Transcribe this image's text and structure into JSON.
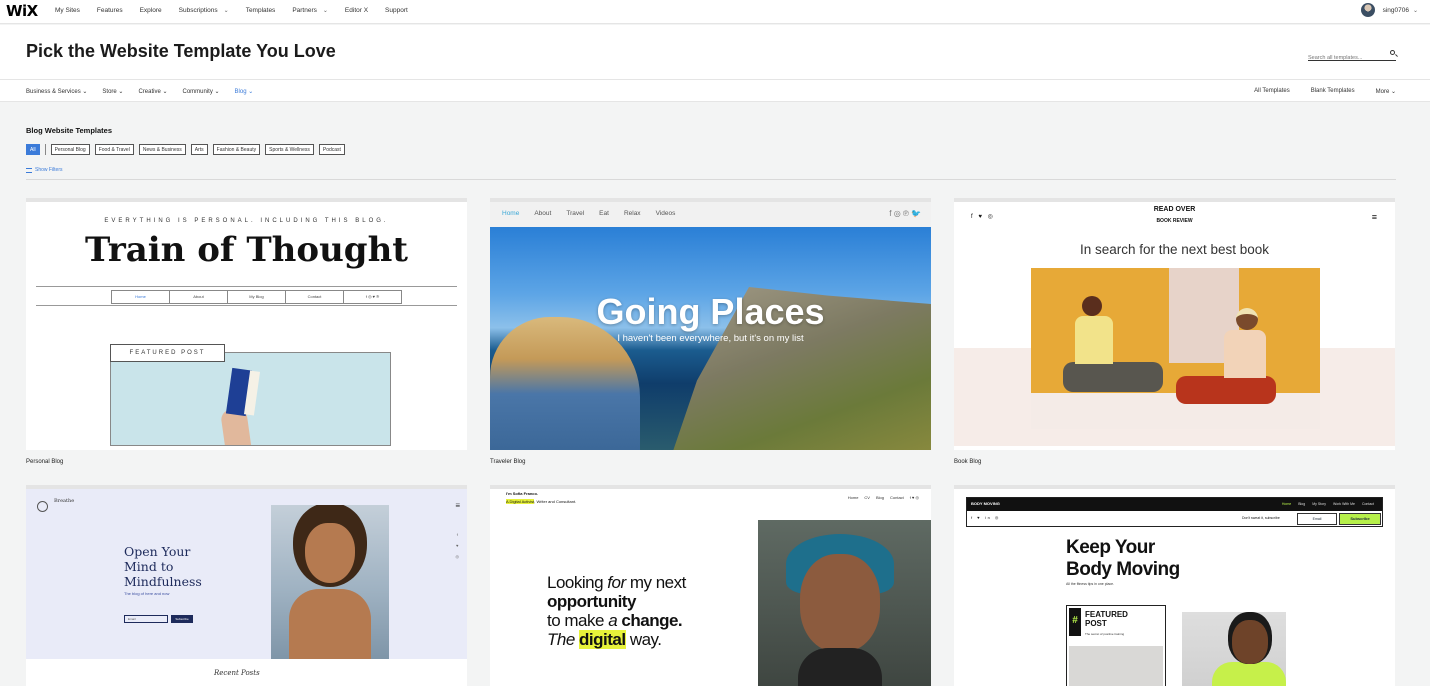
{
  "topnav": {
    "logo": "WiX",
    "items": [
      {
        "label": "My Sites",
        "chevron": false
      },
      {
        "label": "Features",
        "chevron": false
      },
      {
        "label": "Explore",
        "chevron": false
      },
      {
        "label": "Subscriptions",
        "chevron": true
      },
      {
        "label": "Templates",
        "chevron": false
      },
      {
        "label": "Partners",
        "chevron": true
      },
      {
        "label": "Editor X",
        "chevron": false
      },
      {
        "label": "Support",
        "chevron": false
      }
    ],
    "username": "sing0706"
  },
  "header": {
    "title": "Pick the Website Template You Love",
    "search_placeholder": "Search all templates..."
  },
  "categories": {
    "left": [
      "Business & Services",
      "Store",
      "Creative",
      "Community",
      "Blog"
    ],
    "active": "Blog",
    "right": [
      "All Templates",
      "Blank Templates",
      "More"
    ]
  },
  "section": {
    "title": "Blog Website Templates",
    "chips": [
      "All",
      "Personal Blog",
      "Food & Travel",
      "News & Business",
      "Arts",
      "Fashion & Beauty",
      "Sports & Wellness",
      "Podcast"
    ],
    "active_chip": "All",
    "show_filters": "Show Filters"
  },
  "cards": {
    "personal": {
      "label": "Personal Blog",
      "tagline": "EVERYTHING IS PERSONAL. INCLUDING THIS BLOG.",
      "title": "Train of Thought",
      "nav": [
        "Home",
        "About",
        "My Blog",
        "Contact",
        "f ◎ ♥ ℗"
      ],
      "featured": "FEATURED POST"
    },
    "traveler": {
      "label": "Traveler Blog",
      "nav": [
        "Home",
        "About",
        "Travel",
        "Eat",
        "Relax",
        "Videos"
      ],
      "social": "f ◎ ℗ 🐦",
      "title": "Going Places",
      "subtitle": "I haven't been everywhere, but it's on my list"
    },
    "book": {
      "label": "Book Blog",
      "social": "f ♥ ◎",
      "logo_top": "READ OVER",
      "logo_bottom": "BOOK REVIEW",
      "tagline": "In search for the next best book"
    },
    "mindfulness": {
      "brand": "Breathe",
      "heading_lines": [
        "Open Your",
        "Mind to",
        "Mindfulness"
      ],
      "subline": "The blog of here and now",
      "email": "Email",
      "button": "Subscribe",
      "script": "Recent Posts"
    },
    "digital": {
      "name_line1": "I'm Sofia Franco.",
      "name_line2_hl": "A Digital Activist",
      "name_line2_rest": ", Writer and Consultant.",
      "nav": [
        "Home",
        "CV",
        "Blog",
        "Contact",
        "f ♥ ◎"
      ],
      "l1a": "Looking ",
      "l1b": "for",
      "l1c": " my next",
      "l2": "opportunity",
      "l3a": "to make ",
      "l3b": "a",
      "l3c": " change.",
      "l4a": "The ",
      "l4b": "digital",
      "l4c": " way."
    },
    "fitness": {
      "brand": "BODY MOVING",
      "nav": [
        "Home",
        "Blog",
        "My Story",
        "Work With Me",
        "Contact"
      ],
      "social": "f ♥ in ◎",
      "dont": "Don't sweat it, subscribe",
      "email": "Email",
      "subscribe": "Subscribe",
      "heading_line1": "Keep Your",
      "heading_line2": "Body Moving",
      "tagline": "All the fitness tips in one place.",
      "featured_line1": "FEATURED",
      "featured_line2": "POST",
      "featured_sub": "The secret of positive training"
    }
  }
}
